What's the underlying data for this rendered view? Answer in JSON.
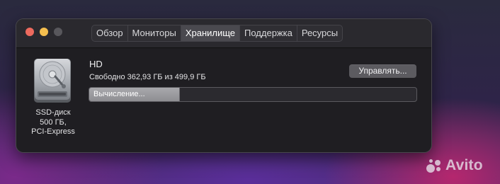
{
  "window": {
    "tabs": [
      {
        "label": "Обзор",
        "active": false
      },
      {
        "label": "Мониторы",
        "active": false
      },
      {
        "label": "Хранилище",
        "active": true
      },
      {
        "label": "Поддержка",
        "active": false
      },
      {
        "label": "Ресурсы",
        "active": false
      }
    ]
  },
  "disk": {
    "icon": "hard-drive-icon",
    "caption": [
      "SSD-диск",
      "500 ГБ,",
      "PCI-Express"
    ],
    "name": "HD",
    "free_text": "Свободно 362,93 ГБ из 499,9 ГБ",
    "manage_label": "Управлять...",
    "bar_label": "Вычисление...",
    "bar_fraction": 0.275
  },
  "watermark": {
    "text": "Avito"
  },
  "colors": {
    "close": "#ed6a5e",
    "minimize": "#f5bf4f",
    "zoom": "#58575c",
    "window_bg": "#1f1e22",
    "button_bg": "#5c5b60"
  }
}
